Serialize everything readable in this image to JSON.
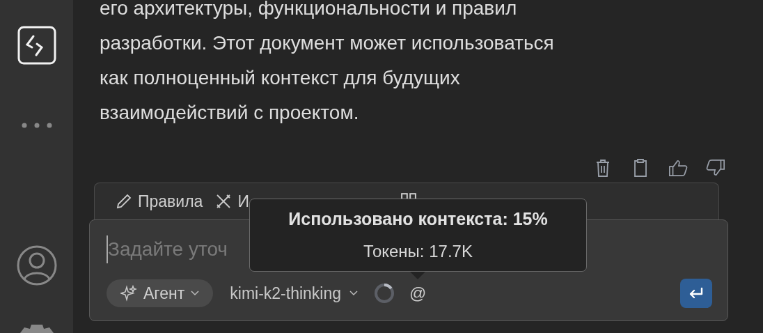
{
  "message": {
    "lines": [
      "его архитектуры, функциональности и правил",
      "разработки. Этот документ может использоваться",
      "как полноценный контекст для будущих",
      "взаимодействий с проектом."
    ]
  },
  "context_tabs": [
    {
      "kind": "rules",
      "label": "Правила"
    },
    {
      "kind": "tools",
      "label": "И"
    },
    {
      "kind": "mcp"
    }
  ],
  "tooltip": {
    "title": "Использовано контекста: 15%",
    "tokens": "Токены: 17.7K"
  },
  "composer": {
    "placeholder": "Задайте уточ",
    "mode": "Агент",
    "model": "kimi-k2-thinking",
    "context_meter": {
      "level": 0.15
    },
    "mention": "@"
  }
}
